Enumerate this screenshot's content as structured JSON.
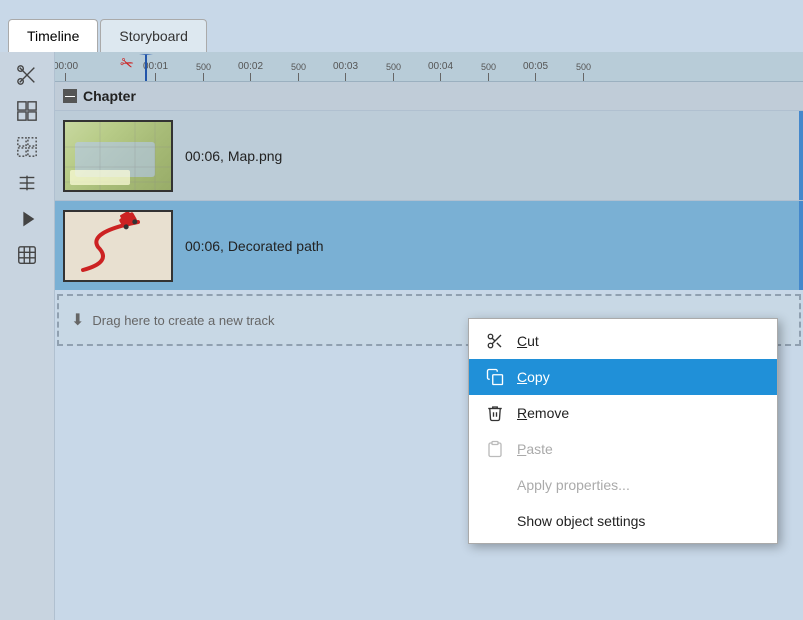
{
  "tabs": [
    {
      "id": "timeline",
      "label": "Timeline",
      "active": true
    },
    {
      "id": "storyboard",
      "label": "Storyboard",
      "active": false
    }
  ],
  "toolbar": {
    "icons": [
      {
        "name": "split-icon",
        "glyph": "✂"
      },
      {
        "name": "group-icon",
        "glyph": "⊞"
      },
      {
        "name": "ungroup-icon",
        "glyph": "⊟"
      },
      {
        "name": "properties-icon",
        "glyph": "⚙"
      },
      {
        "name": "arrow-right-icon",
        "glyph": "▶"
      },
      {
        "name": "delete-icon",
        "glyph": "⊠"
      }
    ]
  },
  "ruler": {
    "marks": [
      {
        "pos": 0,
        "label": "00:00"
      },
      {
        "pos": 90,
        "label": "00:01"
      },
      {
        "pos": 180,
        "label": "00:02"
      },
      {
        "pos": 270,
        "label": "00:03"
      },
      {
        "pos": 360,
        "label": "00:04"
      },
      {
        "pos": 450,
        "label": "00:05"
      }
    ]
  },
  "chapter": {
    "label": "Chapter"
  },
  "tracks": [
    {
      "id": "track-1",
      "type": "image",
      "selected": false,
      "duration": "00:06",
      "filename": "Map.png",
      "display_text": "00:06, Map.png"
    },
    {
      "id": "track-2",
      "type": "path",
      "selected": true,
      "duration": "00:06",
      "filename": "Decorated path",
      "display_text": "00:06, Decorated path"
    }
  ],
  "drag_drop": {
    "label": "Drag here to create a new track"
  },
  "context_menu": {
    "items": [
      {
        "id": "cut",
        "label": "Cut",
        "icon": "✂",
        "disabled": false,
        "highlighted": false,
        "shortcut": ""
      },
      {
        "id": "copy",
        "label": "Copy",
        "icon": "⧉",
        "disabled": false,
        "highlighted": true,
        "shortcut": ""
      },
      {
        "id": "remove",
        "label": "Remove",
        "icon": "🗑",
        "disabled": false,
        "highlighted": false,
        "shortcut": ""
      },
      {
        "id": "paste",
        "label": "Paste",
        "icon": "📋",
        "disabled": true,
        "highlighted": false,
        "shortcut": ""
      },
      {
        "id": "apply-properties",
        "label": "Apply properties...",
        "icon": "",
        "disabled": true,
        "highlighted": false,
        "shortcut": ""
      },
      {
        "id": "show-settings",
        "label": "Show object settings",
        "icon": "",
        "disabled": false,
        "highlighted": false,
        "shortcut": ""
      }
    ]
  }
}
